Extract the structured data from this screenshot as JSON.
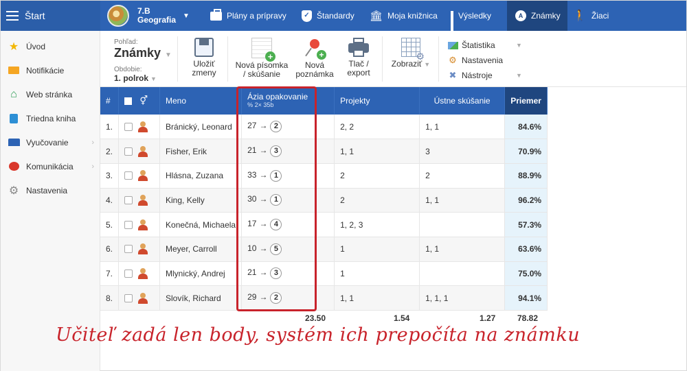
{
  "topbar": {
    "start_label": "Štart",
    "class_name": "7.B",
    "subject": "Geografia",
    "items": [
      {
        "label": "Plány a prípravy",
        "icon": "briefcase-icon"
      },
      {
        "label": "Štandardy",
        "icon": "shield-icon"
      },
      {
        "label": "Moja knižnica",
        "icon": "library-icon"
      },
      {
        "label": "Výsledky",
        "icon": "bar-chart-icon"
      },
      {
        "label": "Známky",
        "icon": "medal-icon",
        "active": true
      },
      {
        "label": "Žiaci",
        "icon": "students-icon"
      }
    ]
  },
  "sidebar": {
    "items": [
      {
        "label": "Úvod",
        "icon": "star-icon"
      },
      {
        "label": "Notifikácie",
        "icon": "envelope-icon"
      },
      {
        "label": "Web stránka",
        "icon": "home-icon"
      },
      {
        "label": "Triedna kniha",
        "icon": "book-icon"
      },
      {
        "label": "Vyučovanie",
        "icon": "open-book-icon",
        "chevron": "›"
      },
      {
        "label": "Komunikácia",
        "icon": "chat-icon",
        "chevron": "›"
      },
      {
        "label": "Nastavenia",
        "icon": "gear-icon"
      }
    ]
  },
  "toolbar": {
    "view_label": "Pohľad:",
    "view_value": "Známky",
    "term_label": "Obdobie:",
    "term_value": "1. polrok",
    "save": [
      "Uložiť",
      "zmeny"
    ],
    "new_test": [
      "Nová písomka",
      "/ skúšanie"
    ],
    "new_note": [
      "Nová",
      "poznámka"
    ],
    "print": [
      "Tlač /",
      "export"
    ],
    "show": "Zobraziť",
    "menu": [
      "Štatistika",
      "Nastavenia",
      "Nástroje"
    ]
  },
  "table": {
    "headers": {
      "num": "#",
      "gender": "⚥",
      "name": "Meno",
      "test_title": "Ázia opakovanie",
      "test_sub": "%  2×  35b",
      "projects": "Projekty",
      "oral": "Ústne skúšanie",
      "average": "Priemer"
    },
    "rows": [
      {
        "num": "1.",
        "name": "Bránický, Leonard",
        "points": "27",
        "grade": "2",
        "projects": "2, 2",
        "oral": "1, 1",
        "avg": "84.6%"
      },
      {
        "num": "2.",
        "name": "Fisher, Erik",
        "points": "21",
        "grade": "3",
        "projects": "1, 1",
        "oral": "3",
        "avg": "70.9%"
      },
      {
        "num": "3.",
        "name": "Hlásna, Zuzana",
        "points": "33",
        "grade": "1",
        "projects": "2",
        "oral": "2",
        "avg": "88.9%"
      },
      {
        "num": "4.",
        "name": "King, Kelly",
        "points": "30",
        "grade": "1",
        "projects": "2",
        "oral": "1, 1",
        "avg": "96.2%"
      },
      {
        "num": "5.",
        "name": "Konečná, Michaela",
        "points": "17",
        "grade": "4",
        "projects": "1, 2, 3",
        "oral": "",
        "avg": "57.3%"
      },
      {
        "num": "6.",
        "name": "Meyer, Carroll",
        "points": "10",
        "grade": "5",
        "projects": "1",
        "oral": "1, 1",
        "avg": "63.6%"
      },
      {
        "num": "7.",
        "name": "Mlynický, Andrej",
        "points": "21",
        "grade": "3",
        "projects": "1",
        "oral": "",
        "avg": "75.0%"
      },
      {
        "num": "8.",
        "name": "Slovík, Richard",
        "points": "29",
        "grade": "2",
        "projects": "1, 1",
        "oral": "1, 1, 1",
        "avg": "94.1%"
      }
    ],
    "footer": {
      "test": "23.50",
      "projects": "1.54",
      "oral": "1.27",
      "avg": "78.82"
    }
  },
  "annotation": {
    "text": "Učiteľ zadá len body, systém ich prepočíta na známku",
    "color": "#c8232b"
  },
  "colors": {
    "topbar": "#2d63b4",
    "active_tab": "#1f467f",
    "average_column": "#e6f3fb"
  }
}
